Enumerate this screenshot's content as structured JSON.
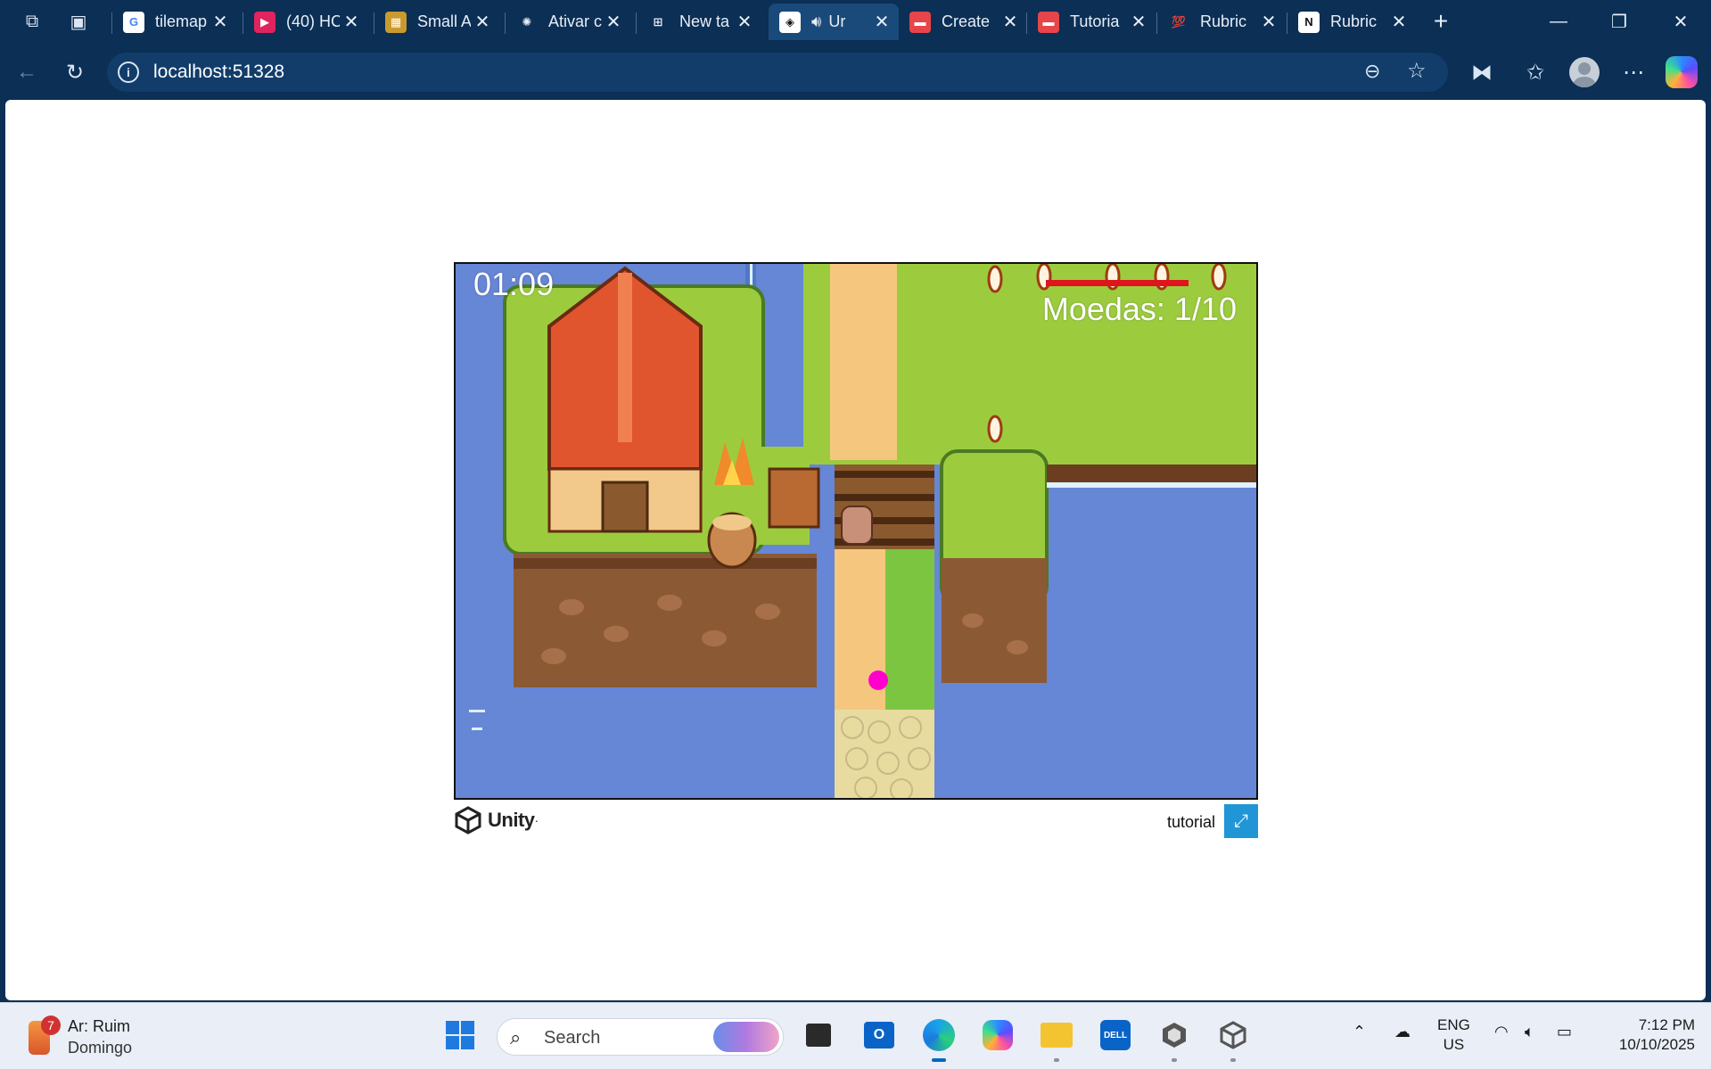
{
  "browser": {
    "tabs": [
      {
        "title": "tilemap",
        "fav": "G",
        "fav_color": "#ffffff",
        "fav_text": "#4285f4"
      },
      {
        "title": "(40) HC",
        "fav": "▶",
        "fav_color": "#e0245e",
        "fav_text": "#ffffff"
      },
      {
        "title": "Small A",
        "fav": "▦",
        "fav_color": "#c99a2e",
        "fav_text": "#ffffff"
      },
      {
        "title": "Ativar c",
        "fav": "✺",
        "fav_color": "#0b2f55",
        "fav_text": "#e8eef6"
      },
      {
        "title": "New ta",
        "fav": "⊞",
        "fav_color": "#0b2f55",
        "fav_text": "#e8eef6"
      },
      {
        "title": "Ur",
        "fav": "◈",
        "fav_color": "#ffffff",
        "fav_text": "#111111"
      },
      {
        "title": "Create",
        "fav": "▬",
        "fav_color": "#e8454a",
        "fav_text": "#ffffff"
      },
      {
        "title": "Tutoria",
        "fav": "▬",
        "fav_color": "#e8454a",
        "fav_text": "#ffffff"
      },
      {
        "title": "Rubric",
        "fav": "💯",
        "fav_color": "#0b2f55",
        "fav_text": "#e03030"
      },
      {
        "title": "Rubric",
        "fav": "N",
        "fav_color": "#ffffff",
        "fav_text": "#111111"
      }
    ],
    "new_tab": "+",
    "url": "localhost:51328"
  },
  "game": {
    "timer": "01:09",
    "coins_text": "Moedas: 1/10",
    "build_title": "tutorial",
    "logo_text": "Unity",
    "logo_mark": "·"
  },
  "taskbar": {
    "weather_badge": "7",
    "weather_title": "Ar: Ruim",
    "weather_sub": "Domingo",
    "search_label": "Search",
    "lang_line1": "ENG",
    "lang_line2": "US",
    "time": "7:12 PM",
    "date": "10/10/2025"
  }
}
